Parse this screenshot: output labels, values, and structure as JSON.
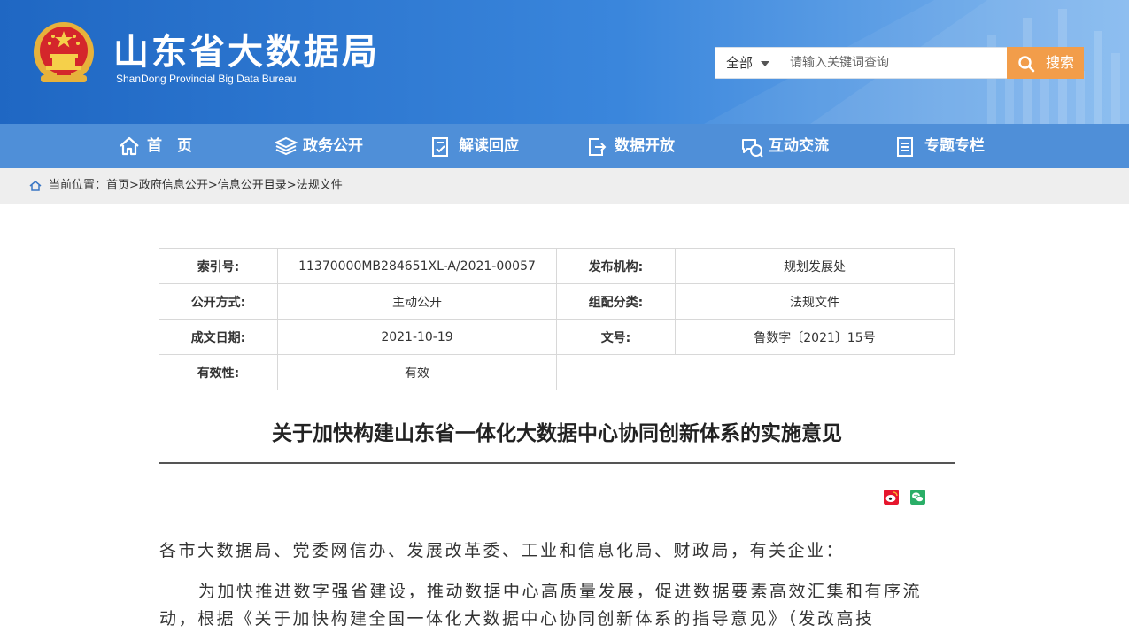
{
  "header": {
    "title": "山东省大数据局",
    "subtitle": "ShanDong Provincial Big Data Bureau"
  },
  "search": {
    "scope": "全部",
    "placeholder": "请输入关键词查询",
    "button": "搜索"
  },
  "nav": [
    {
      "label": "首　页",
      "icon": "home-icon"
    },
    {
      "label": "政务公开",
      "icon": "layers-icon"
    },
    {
      "label": "解读回应",
      "icon": "document-check-icon"
    },
    {
      "label": "数据开放",
      "icon": "export-icon"
    },
    {
      "label": "互动交流",
      "icon": "chat-icon"
    },
    {
      "label": "专题专栏",
      "icon": "list-icon"
    }
  ],
  "breadcrumb": {
    "prefix": "当前位置：",
    "path": "首页>政府信息公开>信息公开目录>法规文件"
  },
  "meta": {
    "index_label": "索引号:",
    "index_value": "11370000MB284651XL-A/2021-00057",
    "publisher_label": "发布机构:",
    "publisher_value": "规划发展处",
    "open_label": "公开方式:",
    "open_value": "主动公开",
    "category_label": "组配分类:",
    "category_value": "法规文件",
    "date_label": "成文日期:",
    "date_value": "2021-10-19",
    "docno_label": "文号:",
    "docno_value": "鲁数字〔2021〕15号",
    "validity_label": "有效性:",
    "validity_value": "有效"
  },
  "article": {
    "title": "关于加快构建山东省一体化大数据中心协同创新体系的实施意见",
    "recipients": "各市大数据局、党委网信办、发展改革委、工业和信息化局、财政局，有关企业：",
    "body": "为加快推进数字强省建设，推动数据中心高质量发展，促进数据要素高效汇集和有序流动，根据《关于加快构建全国一体化大数据中心协同创新体系的指导意见》（发改高技"
  },
  "colors": {
    "header": "#2a74cf",
    "nav": "#4f8fd8",
    "search_button": "#f29d4a",
    "weibo": "#e6162d",
    "wechat": "#2aae67"
  }
}
